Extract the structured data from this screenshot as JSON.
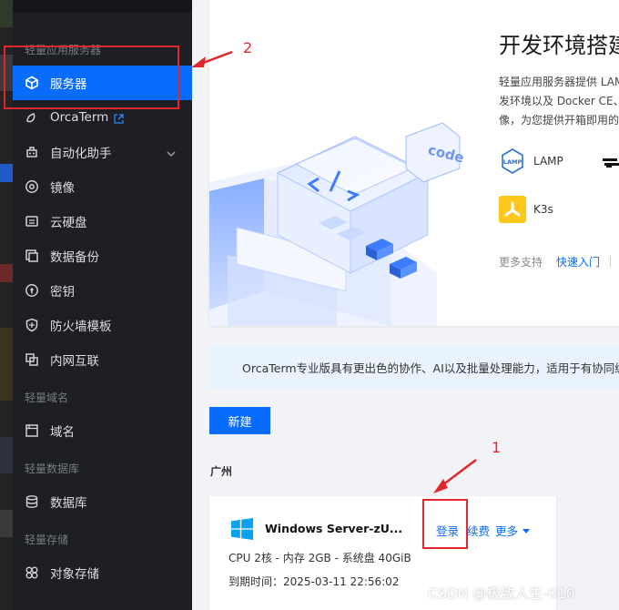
{
  "sidebar": {
    "groups": [
      {
        "title": "轻量应用服务器"
      },
      {
        "title": "轻量域名"
      },
      {
        "title": "轻量数据库"
      },
      {
        "title": "轻量存储"
      }
    ],
    "items": [
      {
        "label": "服务器",
        "icon": "cube-icon",
        "active": true
      },
      {
        "label": "OrcaTerm",
        "icon": "orcaterm-icon"
      },
      {
        "label": "自动化助手",
        "icon": "automation-icon"
      },
      {
        "label": "镜像",
        "icon": "image-disc-icon"
      },
      {
        "label": "云硬盘",
        "icon": "cloud-disk-icon"
      },
      {
        "label": "数据备份",
        "icon": "backup-icon"
      },
      {
        "label": "密钥",
        "icon": "key-icon"
      },
      {
        "label": "防火墙模板",
        "icon": "firewall-icon"
      },
      {
        "label": "内网互联",
        "icon": "network-icon"
      },
      {
        "label": "域名",
        "icon": "domain-icon"
      },
      {
        "label": "数据库",
        "icon": "database-icon"
      },
      {
        "label": "对象存储",
        "icon": "object-storage-icon"
      }
    ]
  },
  "hero": {
    "title": "开发环境搭建",
    "desc_lines": [
      "轻量应用服务器提供 LAMP",
      "发环境以及 Docker CE、",
      "像，为您提供开箱即用的"
    ],
    "code_label": "code",
    "techs": [
      {
        "label": "LAMP",
        "icon": "lamp-icon"
      },
      {
        "label": "K3s",
        "icon": "k3s-icon"
      }
    ],
    "more_support": "更多支持",
    "quick_start": "快速入门"
  },
  "notice": {
    "text": "OrcaTerm专业版具有更出色的协作、AI以及批量处理能力，适用于有协同编"
  },
  "toolbar": {
    "new_label": "新建"
  },
  "region": "广州",
  "instance": {
    "name": "Windows Server-zU...",
    "login": "登录",
    "renew": "续费",
    "more": "更多",
    "spec": "CPU 2核 - 内存 2GB - 系统盘 40GiB",
    "expire": "到期时间：2025-03-11 22:56:02"
  },
  "annotations": {
    "num1": "1",
    "num2": "2"
  },
  "watermark": "CSDN @极致人生-010",
  "colors": {
    "accent": "#0a6cff",
    "sidebar_bg": "#1d1f24",
    "annotation": "#e0272c"
  }
}
